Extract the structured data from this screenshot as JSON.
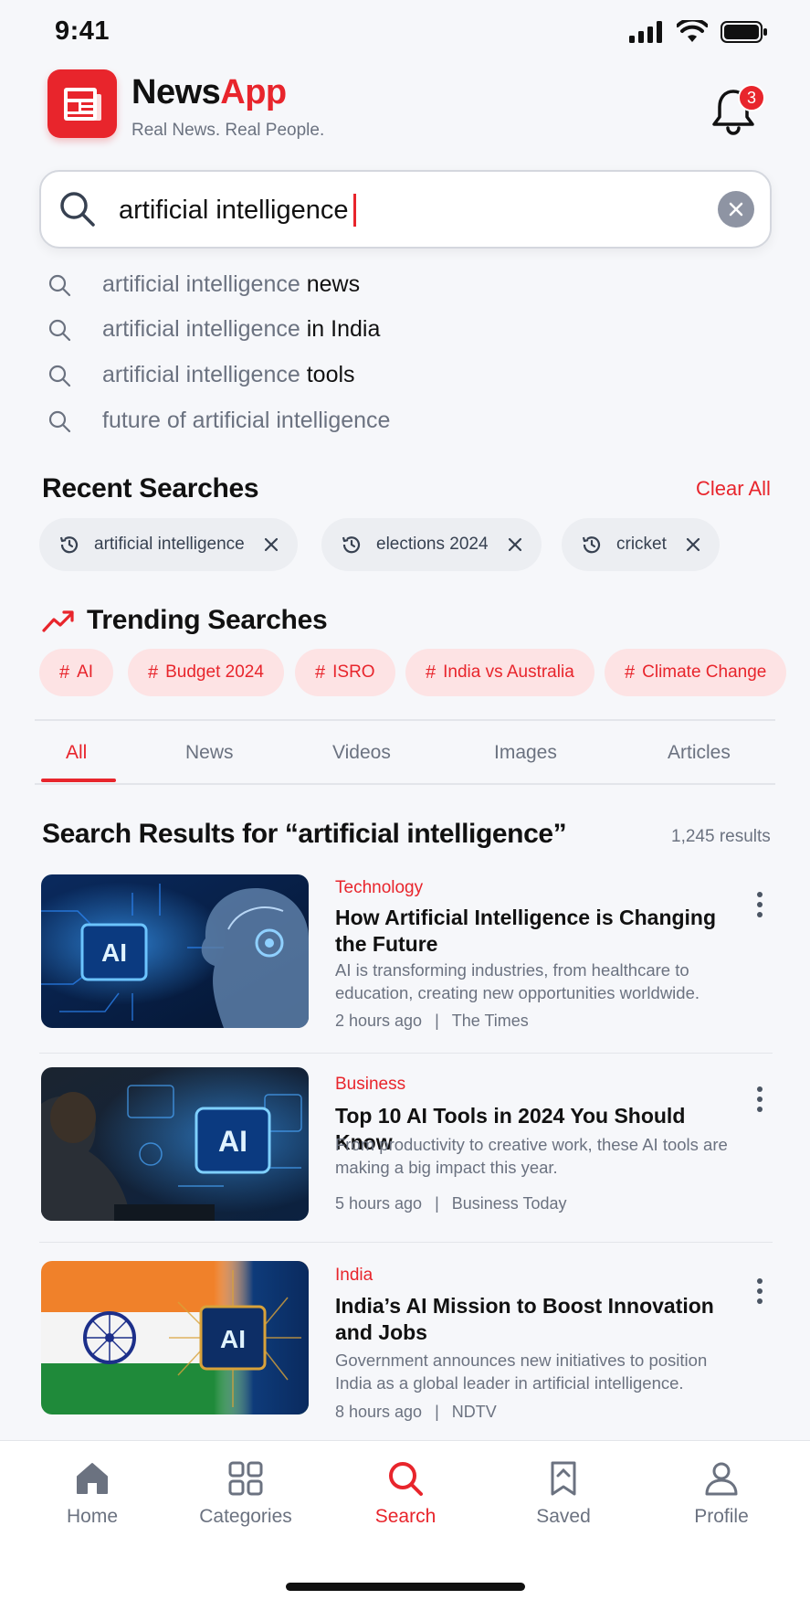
{
  "status": {
    "time": "9:41"
  },
  "header": {
    "brand_prefix": "News",
    "brand_suffix": "App",
    "logo_text": "NEWS",
    "tagline": "Real News. Real People.",
    "notification_count": "3"
  },
  "search": {
    "value": "artificial intelligence",
    "suggestions": [
      {
        "prefix": "artificial intelligence",
        "suffix": " news"
      },
      {
        "prefix": "artificial intelligence",
        "suffix": " in India"
      },
      {
        "prefix": "artificial intelligence",
        "suffix": " tools"
      },
      {
        "prefix": "future of artificial intelligence",
        "suffix": ""
      }
    ]
  },
  "recent": {
    "title": "Recent Searches",
    "clear_label": "Clear All",
    "items": [
      "artificial intelligence",
      "elections 2024",
      "cricket"
    ]
  },
  "trending": {
    "title": "Trending Searches",
    "items": [
      "AI",
      "Budget 2024",
      "ISRO",
      "India vs Australia",
      "Climate Change"
    ]
  },
  "tabs": [
    "All",
    "News",
    "Videos",
    "Images",
    "Articles"
  ],
  "results": {
    "title": "Search Results for “artificial intelligence”",
    "count": "1,245 results",
    "items": [
      {
        "category": "Technology",
        "headline": "How Artificial Intelligence is Changing the Future",
        "snippet": "AI is transforming industries, from healthcare to education, creating new opportunities worldwide.",
        "time": "2 hours ago",
        "source": "The Times",
        "image_label": "AI"
      },
      {
        "category": "Business",
        "headline": "Top 10 AI Tools in 2024 You Should Know",
        "snippet": "From productivity to creative work, these AI tools are making a big impact this year.",
        "time": "5 hours ago",
        "source": "Business Today",
        "image_label": "AI"
      },
      {
        "category": "India",
        "headline": "India’s AI Mission to Boost Innovation and Jobs",
        "snippet": "Government announces new initiatives to position India as a global leader in artificial intelligence.",
        "time": "8 hours ago",
        "source": "NDTV",
        "image_label": "AI"
      }
    ]
  },
  "nav": [
    {
      "label": "Home",
      "icon": "home-icon"
    },
    {
      "label": "Categories",
      "icon": "grid-icon"
    },
    {
      "label": "Search",
      "icon": "search-icon"
    },
    {
      "label": "Saved",
      "icon": "bookmark-icon"
    },
    {
      "label": "Profile",
      "icon": "person-icon"
    }
  ],
  "colors": {
    "accent": "#e8252c",
    "muted": "#6b7280",
    "chip_bg": "#eceef2",
    "trend_bg": "#fde3e4"
  }
}
